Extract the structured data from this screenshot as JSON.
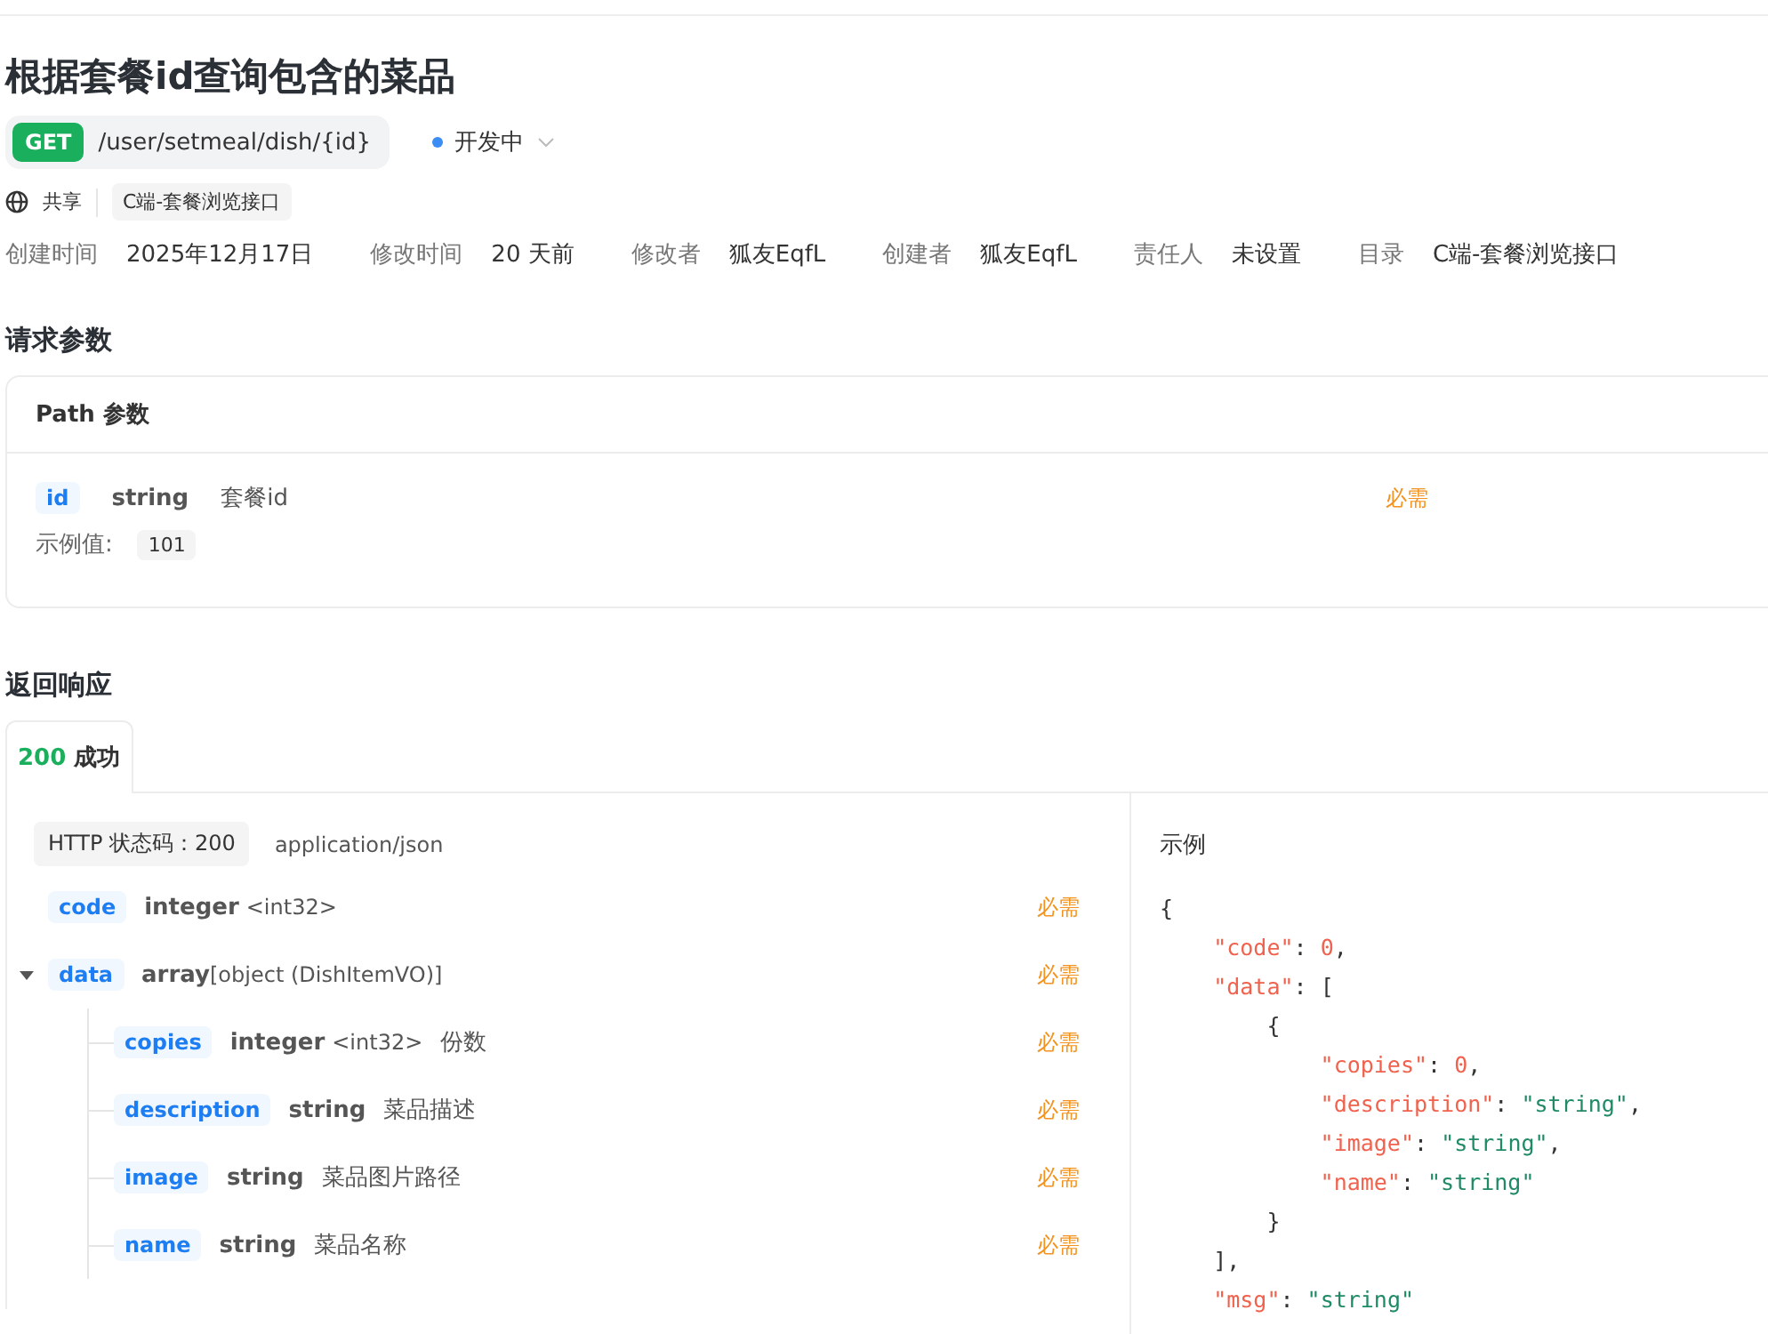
{
  "title": "根据套餐id查询包含的菜品",
  "endpoint": {
    "method": "GET",
    "path": "/user/setmeal/dish/{id}",
    "status": {
      "label": "开发中",
      "color": "#3b8cf5"
    }
  },
  "share": {
    "label": "共享",
    "folder_tag": "C端-套餐浏览接口"
  },
  "meta": [
    {
      "label": "创建时间",
      "value": "2025年12月17日"
    },
    {
      "label": "修改时间",
      "value": "20 天前"
    },
    {
      "label": "修改者",
      "value": "狐友EqfL"
    },
    {
      "label": "创建者",
      "value": "狐友EqfL"
    },
    {
      "label": "责任人",
      "value": "未设置"
    },
    {
      "label": "目录",
      "value": "C端-套餐浏览接口"
    }
  ],
  "request": {
    "heading": "请求参数",
    "section": "Path 参数",
    "params": [
      {
        "name": "id",
        "type": "string",
        "description": "套餐id",
        "required": "必需",
        "example_label": "示例值:",
        "example": "101"
      }
    ]
  },
  "response": {
    "heading": "返回响应",
    "tabs": [
      {
        "code": "200",
        "label": "成功",
        "selected": true
      }
    ],
    "status_code": "HTTP 状态码：200",
    "content_type": "application/json",
    "fields": [
      {
        "name": "code",
        "type": "integer",
        "format": "<int32>",
        "required": "必需"
      },
      {
        "name": "data",
        "type": "array",
        "format": "[object (DishItemVO)]",
        "required": "必需",
        "expanded": true,
        "children": [
          {
            "name": "copies",
            "type": "integer",
            "format": "<int32>",
            "description": "份数",
            "required": "必需"
          },
          {
            "name": "description",
            "type": "string",
            "description": "菜品描述",
            "required": "必需"
          },
          {
            "name": "image",
            "type": "string",
            "description": "菜品图片路径",
            "required": "必需"
          },
          {
            "name": "name",
            "type": "string",
            "description": "菜品名称",
            "required": "必需"
          }
        ]
      }
    ],
    "example_title": "示例",
    "example_lines": [
      [
        {
          "kind": "punct",
          "text": "{"
        }
      ],
      [
        {
          "kind": "key",
          "text": "    \"code\""
        },
        {
          "kind": "punct",
          "text": ": "
        },
        {
          "kind": "number",
          "text": "0"
        },
        {
          "kind": "punct",
          "text": ","
        }
      ],
      [
        {
          "kind": "key",
          "text": "    \"data\""
        },
        {
          "kind": "punct",
          "text": ": ["
        }
      ],
      [
        {
          "kind": "punct",
          "text": "        {"
        }
      ],
      [
        {
          "kind": "key",
          "text": "            \"copies\""
        },
        {
          "kind": "punct",
          "text": ": "
        },
        {
          "kind": "number",
          "text": "0"
        },
        {
          "kind": "punct",
          "text": ","
        }
      ],
      [
        {
          "kind": "key",
          "text": "            \"description\""
        },
        {
          "kind": "punct",
          "text": ": "
        },
        {
          "kind": "string",
          "text": "\"string\""
        },
        {
          "kind": "punct",
          "text": ","
        }
      ],
      [
        {
          "kind": "key",
          "text": "            \"image\""
        },
        {
          "kind": "punct",
          "text": ": "
        },
        {
          "kind": "string",
          "text": "\"string\""
        },
        {
          "kind": "punct",
          "text": ","
        }
      ],
      [
        {
          "kind": "key",
          "text": "            \"name\""
        },
        {
          "kind": "punct",
          "text": ": "
        },
        {
          "kind": "string",
          "text": "\"string\""
        }
      ],
      [
        {
          "kind": "punct",
          "text": "        }"
        }
      ],
      [
        {
          "kind": "punct",
          "text": "    ],"
        }
      ],
      [
        {
          "kind": "key",
          "text": "    \"msg\""
        },
        {
          "kind": "punct",
          "text": ": "
        },
        {
          "kind": "string",
          "text": "\"string\""
        }
      ]
    ]
  }
}
